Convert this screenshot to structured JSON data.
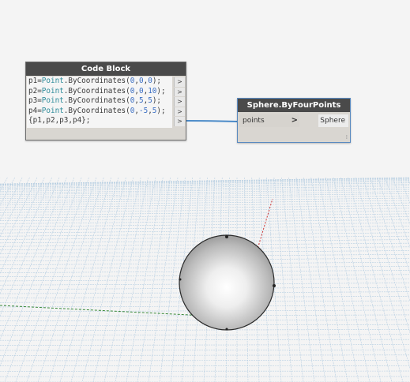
{
  "code_block": {
    "title": "Code Block",
    "lines": [
      [
        {
          "t": "p1=",
          "c": "txt"
        },
        {
          "t": "Point",
          "c": "kw"
        },
        {
          "t": ".ByCoordinates(",
          "c": "txt"
        },
        {
          "t": "0",
          "c": "num"
        },
        {
          "t": ",",
          "c": "txt"
        },
        {
          "t": "0",
          "c": "num"
        },
        {
          "t": ",",
          "c": "txt"
        },
        {
          "t": "0",
          "c": "num"
        },
        {
          "t": ");",
          "c": "txt"
        }
      ],
      [
        {
          "t": "p2=",
          "c": "txt"
        },
        {
          "t": "Point",
          "c": "kw"
        },
        {
          "t": ".ByCoordinates(",
          "c": "txt"
        },
        {
          "t": "0",
          "c": "num"
        },
        {
          "t": ",",
          "c": "txt"
        },
        {
          "t": "0",
          "c": "num"
        },
        {
          "t": ",",
          "c": "txt"
        },
        {
          "t": "10",
          "c": "num"
        },
        {
          "t": ");",
          "c": "txt"
        }
      ],
      [
        {
          "t": "p3=",
          "c": "txt"
        },
        {
          "t": "Point",
          "c": "kw"
        },
        {
          "t": ".ByCoordinates(",
          "c": "txt"
        },
        {
          "t": "0",
          "c": "num"
        },
        {
          "t": ",",
          "c": "txt"
        },
        {
          "t": "5",
          "c": "num"
        },
        {
          "t": ",",
          "c": "txt"
        },
        {
          "t": "5",
          "c": "num"
        },
        {
          "t": ");",
          "c": "txt"
        }
      ],
      [
        {
          "t": "p4=",
          "c": "txt"
        },
        {
          "t": "Point",
          "c": "kw"
        },
        {
          "t": ".ByCoordinates(",
          "c": "txt"
        },
        {
          "t": "0",
          "c": "num"
        },
        {
          "t": ",",
          "c": "txt"
        },
        {
          "t": "-5",
          "c": "num"
        },
        {
          "t": ",",
          "c": "txt"
        },
        {
          "t": "5",
          "c": "num"
        },
        {
          "t": ");",
          "c": "txt"
        }
      ],
      [
        {
          "t": "{p1,p2,p3,p4};",
          "c": "txt"
        }
      ]
    ],
    "output_ports": [
      ">",
      ">",
      ">",
      ">",
      ">"
    ]
  },
  "sphere_node": {
    "title": "Sphere.ByFourPoints",
    "input_label": "points",
    "input_arrow": ">",
    "output_label": "Sphere",
    "resize_glyph": "⁞"
  },
  "colors": {
    "background": "#f4f4f4",
    "grid": "#b8cfe2",
    "x_axis": "#3a8a3a",
    "y_axis": "#cc3333",
    "wire": "#4a8ac8"
  }
}
